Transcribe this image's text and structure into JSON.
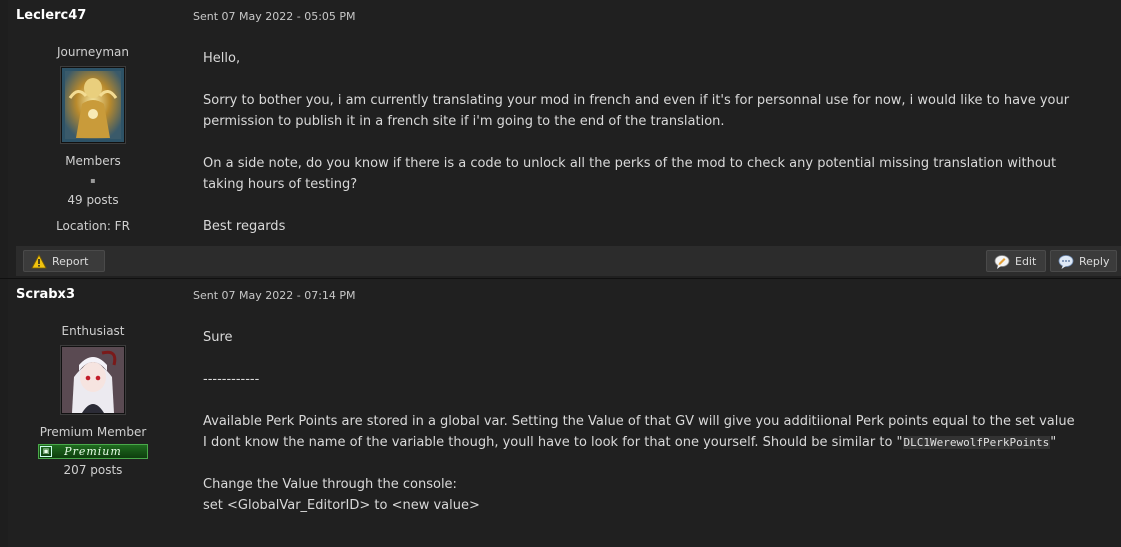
{
  "posts": [
    {
      "username": "Leclerc47",
      "date": "Sent 07 May 2022 - 05:05 PM",
      "rank": "Journeyman",
      "group": "Members",
      "separator": "▪",
      "posts": "49 posts",
      "location": "Location: FR",
      "body": [
        "Hello,",
        "Sorry to bother you, i am currently translating your mod in french and even if it's for personnal use for now, i would like to have your permission to publish it in a french site if i'm going to the end of the translation.",
        "On a side note, do you know if there is a code to unlock all the perks of the mod to check any potential missing translation without taking hours of testing?",
        "Best regards"
      ]
    },
    {
      "username": "Scrabx3",
      "date": "Sent 07 May 2022 - 07:14 PM",
      "rank": "Enthusiast",
      "group": "Premium Member",
      "badge": "Premium",
      "posts": "207 posts",
      "body": {
        "p1": "Sure",
        "p2": "------------",
        "p3_line1": "Available Perk Points are stored in a global var. Setting the Value of that GV will give you additiional Perk points equal to the set value",
        "p3_line2_prefix": "I dont know the name of the variable though, youll have to look for that one yourself. Should be similar to \"",
        "p3_code": "DLC1WerewolfPerkPoints",
        "p3_suffix": "\"",
        "p4_line1": "Change the Value through the console:",
        "p4_line2": "set <GlobalVar_EditorID> to <new value>"
      }
    }
  ],
  "actions": {
    "report": "Report",
    "edit": "Edit",
    "reply": "Reply"
  },
  "icons": {
    "report": "warning-triangle-icon",
    "edit": "edit-bubble-icon",
    "reply": "reply-bubble-icon"
  }
}
